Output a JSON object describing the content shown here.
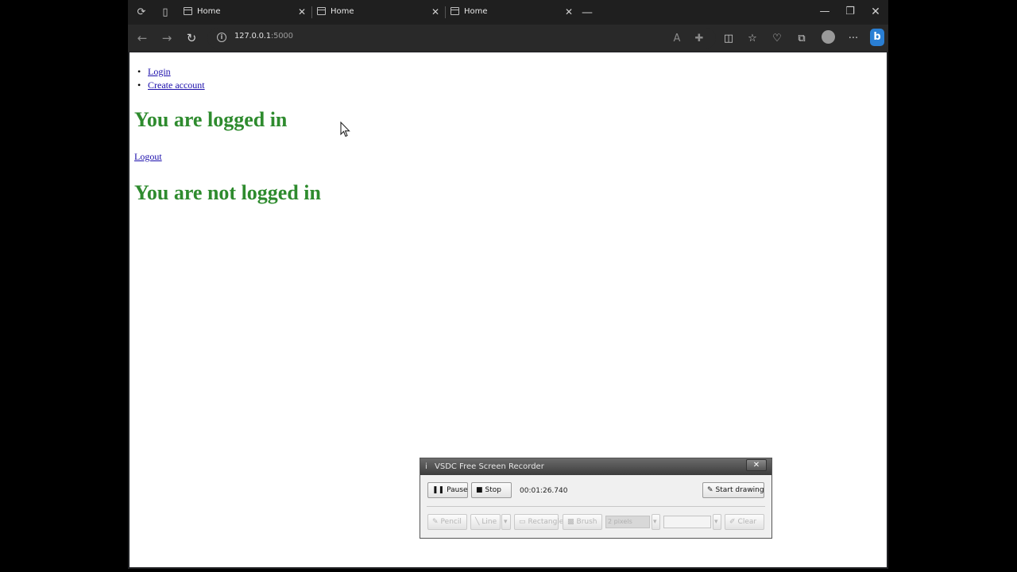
{
  "browser": {
    "tabs": [
      {
        "title": "Home"
      },
      {
        "title": "Home"
      },
      {
        "title": "Home"
      }
    ],
    "url": {
      "host": "127.0.0.1",
      "port": ":5000"
    }
  },
  "page": {
    "nav_links": [
      "Login",
      "Create account"
    ],
    "heading_logged_in": "You are logged in",
    "logout_link": "Logout",
    "heading_not_logged_in": "You are not logged in",
    "heading_color": "#2e8b2e"
  },
  "recorder": {
    "title": "VSDC Free Screen Recorder",
    "pause_label": "Pause",
    "stop_label": "Stop",
    "elapsed": "00:01:26.740",
    "start_drawing_label": "Start drawing",
    "pencil_label": "Pencil",
    "line_label": "Line",
    "rectangle_label": "Rectangle",
    "brush_label": "Brush",
    "size_value": "2 pixels",
    "clear_label": "Clear"
  }
}
